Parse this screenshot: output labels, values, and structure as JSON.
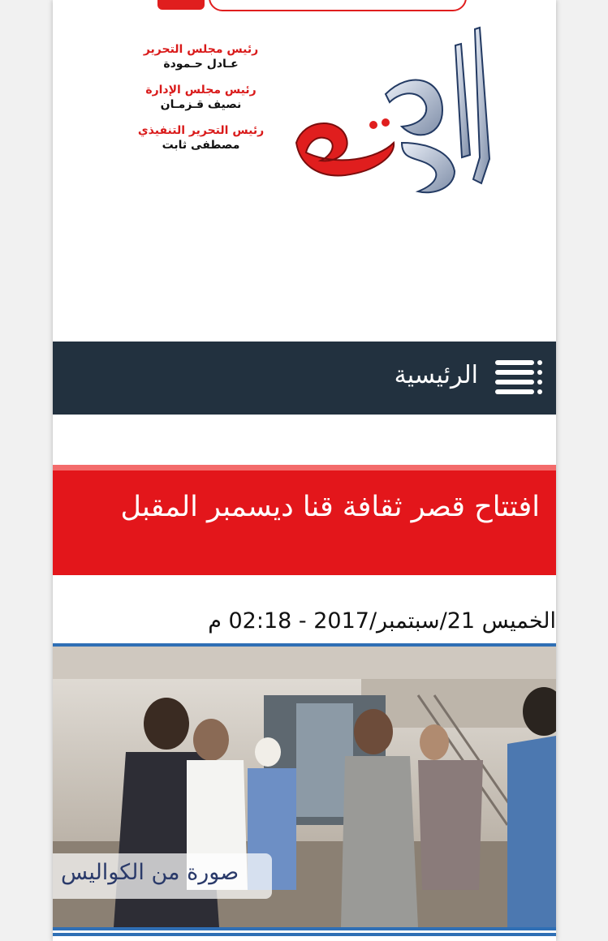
{
  "header": {
    "staff": [
      {
        "role": "رئيس مجلس التحرير",
        "name": "عـادل حـمودة"
      },
      {
        "role": "رئيس مجلس الإدارة",
        "name": "نصيف قـزمـان"
      },
      {
        "role": "رئيس التحرير التنفيذي",
        "name": "مصطفى ثابت"
      }
    ],
    "logo_text": "الفجر"
  },
  "nav": {
    "home_label": "الرئيسية"
  },
  "article": {
    "title": "افتتاح قصر ثقافة قنا ديسمبر المقبل",
    "date": "الخميس 21/سبتمبر/2017 - 02:18 م",
    "photo_caption": "صورة من الكواليس"
  },
  "colors": {
    "brand_red": "#e3161b",
    "nav_dark": "#22313f",
    "accent_blue": "#2f6fb5"
  }
}
